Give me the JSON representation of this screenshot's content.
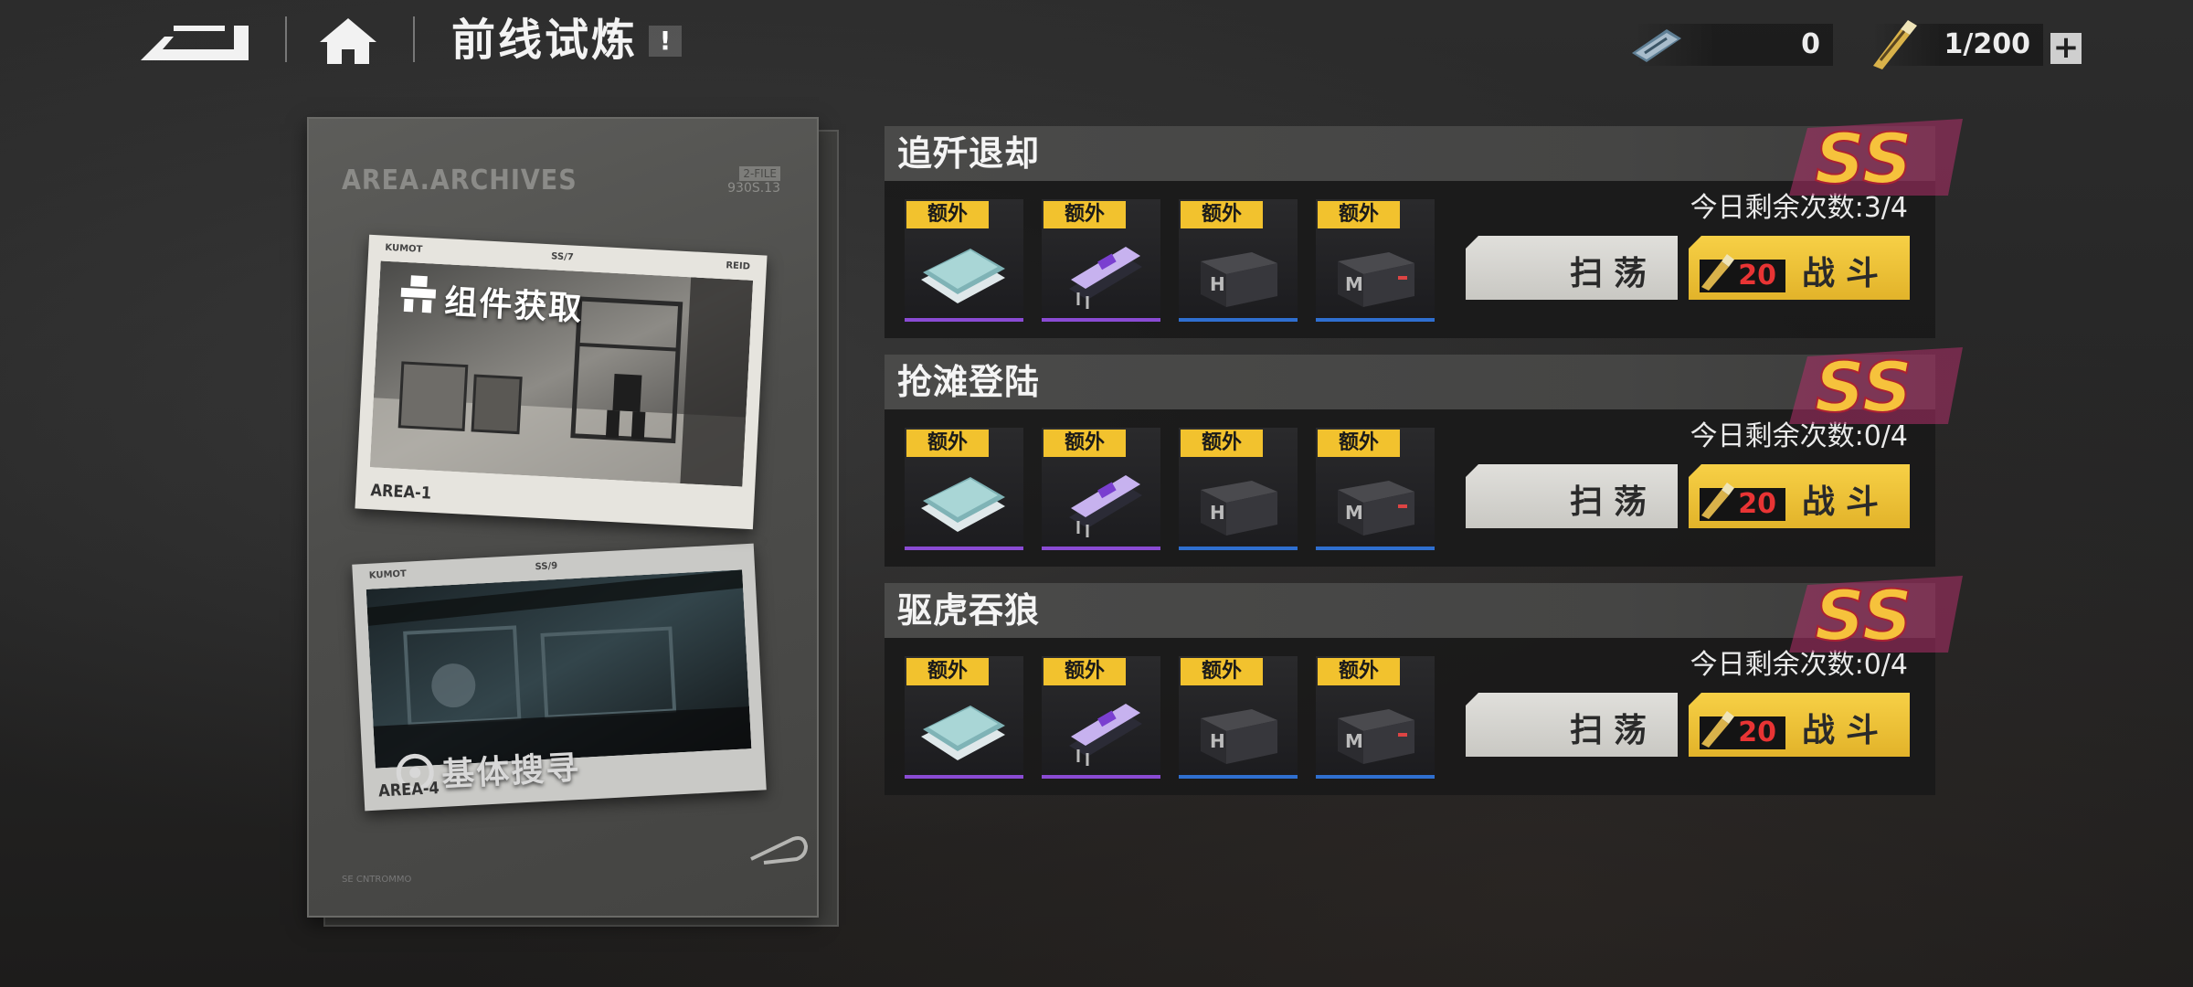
{
  "header": {
    "title": "前线试炼",
    "info_label": "!",
    "resource_ticket": {
      "value": "0",
      "icon": "ticket-card-icon"
    },
    "resource_energy": {
      "value": "1/200",
      "icon": "energy-cartridge-icon"
    },
    "plus_label": "+"
  },
  "archive": {
    "title": "AREA.ARCHIVES",
    "code_tag": "2-FILE",
    "code": "930S.13",
    "footer": "SE CNTROMMO",
    "photos": [
      {
        "label": "组件获取",
        "area": "AREA-1",
        "top_left": "KUMOT",
        "top_mid": "SS/7",
        "top_right": "REID",
        "icon": "mech-icon"
      },
      {
        "label": "基体搜寻",
        "area": "AREA-4",
        "top_left": "KUMOT",
        "top_mid": "SS/9",
        "icon": "target-icon"
      }
    ]
  },
  "stages": [
    {
      "name": "追歼退却",
      "rank": "SS",
      "remaining": "今日剩余次数:3/4",
      "rewards": [
        {
          "tag": "额外",
          "item": "blueprint-cards-icon",
          "rarity": "purple"
        },
        {
          "tag": "额外",
          "item": "chip-module-icon",
          "rarity": "purple"
        },
        {
          "tag": "额外",
          "item": "supply-crate-icon",
          "rarity": "blue"
        },
        {
          "tag": "额外",
          "item": "mech-crate-icon",
          "rarity": "blue"
        }
      ],
      "sweep_label": "扫荡",
      "fight_label": "战斗",
      "cost": "20"
    },
    {
      "name": "抢滩登陆",
      "rank": "SS",
      "remaining": "今日剩余次数:0/4",
      "rewards": [
        {
          "tag": "额外",
          "item": "blueprint-cards-icon",
          "rarity": "purple"
        },
        {
          "tag": "额外",
          "item": "chip-module-icon",
          "rarity": "purple"
        },
        {
          "tag": "额外",
          "item": "supply-crate-icon",
          "rarity": "blue"
        },
        {
          "tag": "额外",
          "item": "mech-crate-icon",
          "rarity": "blue"
        }
      ],
      "sweep_label": "扫荡",
      "fight_label": "战斗",
      "cost": "20"
    },
    {
      "name": "驱虎吞狼",
      "rank": "SS",
      "remaining": "今日剩余次数:0/4",
      "rewards": [
        {
          "tag": "额外",
          "item": "blueprint-cards-icon",
          "rarity": "purple"
        },
        {
          "tag": "额外",
          "item": "chip-module-icon",
          "rarity": "purple"
        },
        {
          "tag": "额外",
          "item": "supply-crate-icon",
          "rarity": "blue"
        },
        {
          "tag": "额外",
          "item": "mech-crate-icon",
          "rarity": "blue"
        }
      ],
      "sweep_label": "扫荡",
      "fight_label": "战斗",
      "cost": "20"
    }
  ],
  "colors": {
    "gold": "#f2c22e",
    "cost_red": "#e83434",
    "rare_purple": "#8a4bd4",
    "rare_blue": "#2f6fd0"
  }
}
